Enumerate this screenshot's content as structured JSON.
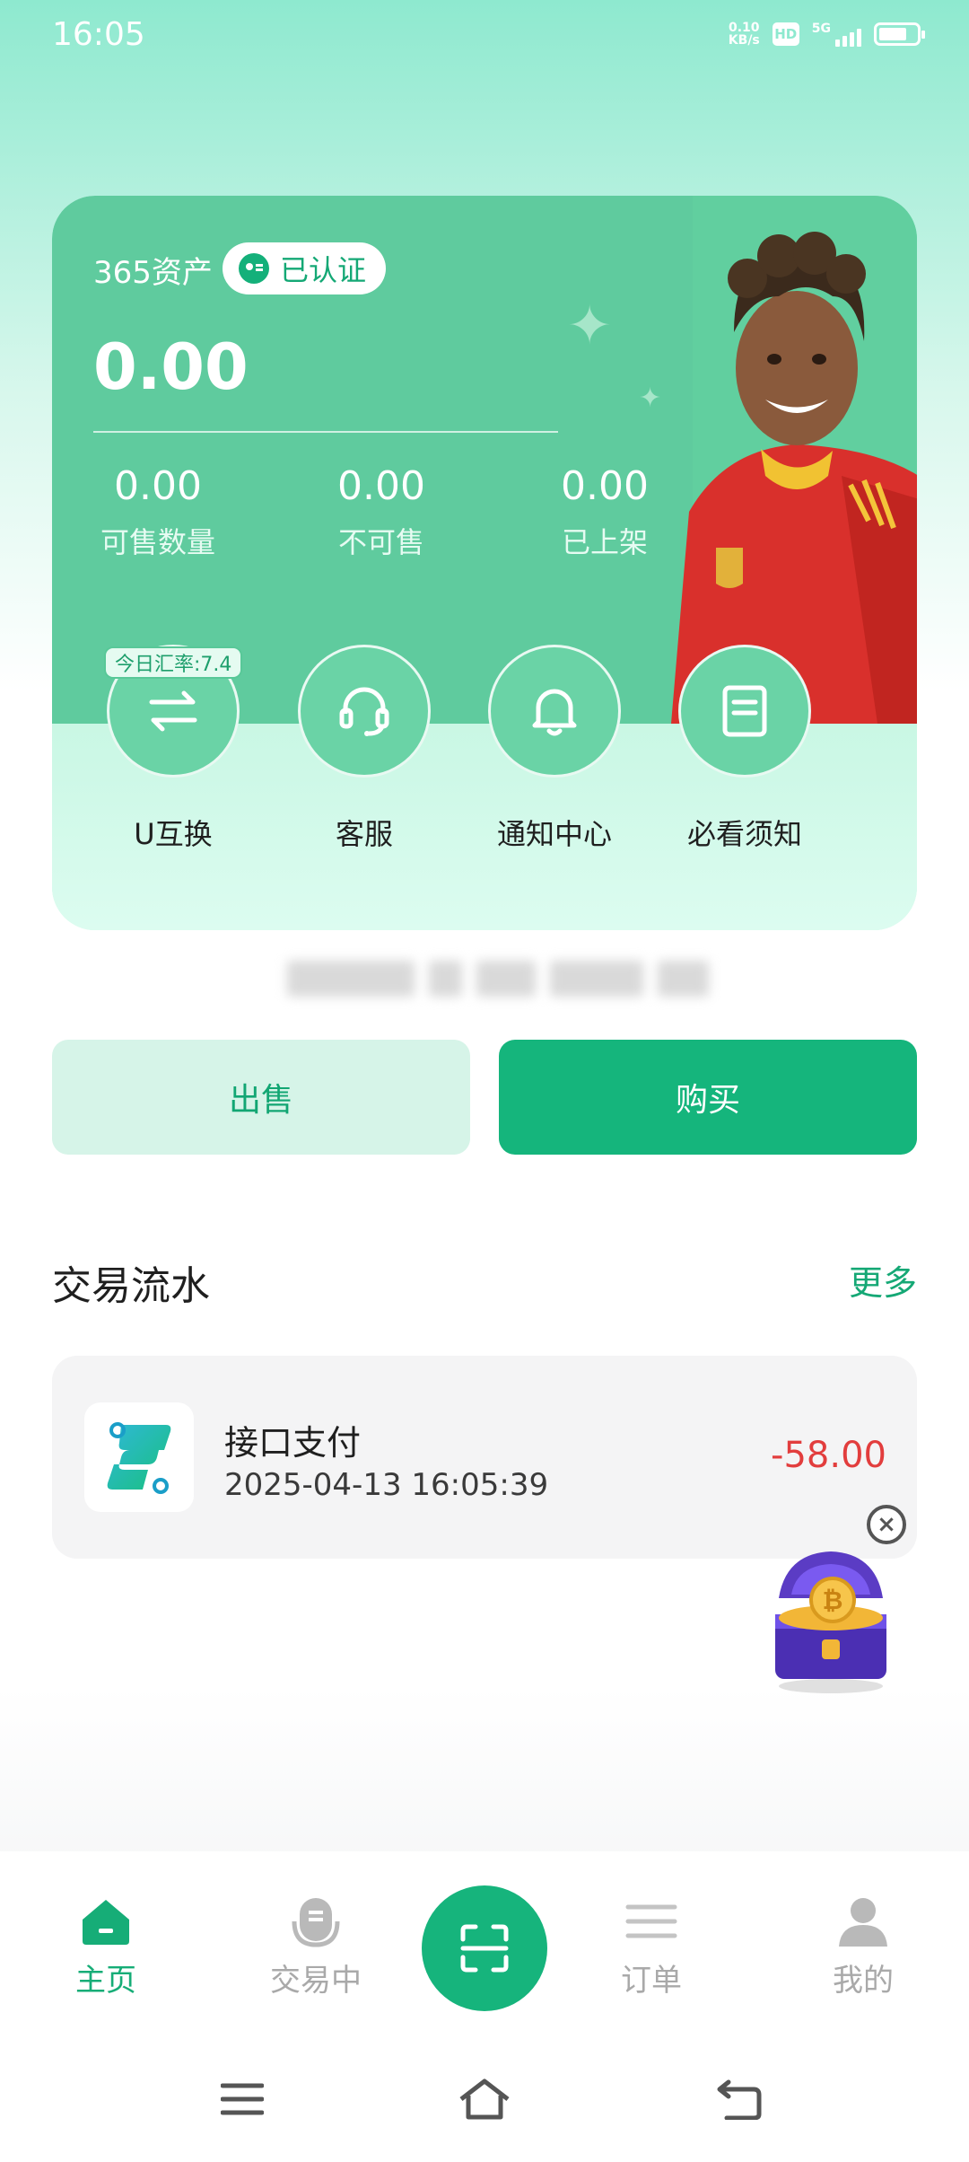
{
  "status_bar": {
    "time": "16:05",
    "net_speed_value": "0.10",
    "net_speed_unit": "KB/s",
    "hd_label": "HD",
    "signal_label": "5G",
    "battery_level": 0.6
  },
  "asset_card": {
    "label": "365资产",
    "verified_label": "已认证",
    "total": "0.00",
    "stats": [
      {
        "value": "0.00",
        "label": "可售数量"
      },
      {
        "value": "0.00",
        "label": "不可售"
      },
      {
        "value": "0.00",
        "label": "已上架"
      }
    ],
    "rate_badge": "今日汇率:7.4",
    "actions": [
      {
        "label": "U互换",
        "icon": "exchange-icon"
      },
      {
        "label": "客服",
        "icon": "headset-icon"
      },
      {
        "label": "通知中心",
        "icon": "bell-icon"
      },
      {
        "label": "必看须知",
        "icon": "document-icon"
      }
    ]
  },
  "trade_buttons": {
    "sell": "出售",
    "buy": "购买"
  },
  "transactions": {
    "title": "交易流水",
    "more": "更多",
    "items": [
      {
        "name": "接口支付",
        "time": "2025-04-13 16:05:39",
        "amount": "-58.00",
        "icon": "app-logo-icon"
      }
    ]
  },
  "bottom_nav": {
    "items": [
      {
        "label": "主页",
        "icon": "home-icon",
        "active": true
      },
      {
        "label": "交易中",
        "icon": "trading-icon",
        "active": false
      },
      {
        "label": "订单",
        "icon": "orders-icon",
        "active": false
      },
      {
        "label": "我的",
        "icon": "profile-icon",
        "active": false
      }
    ],
    "center_icon": "scan-icon"
  },
  "colors": {
    "brand": "#15b57c",
    "card_green": "#5fcb9e",
    "negative": "#e23d3d"
  }
}
